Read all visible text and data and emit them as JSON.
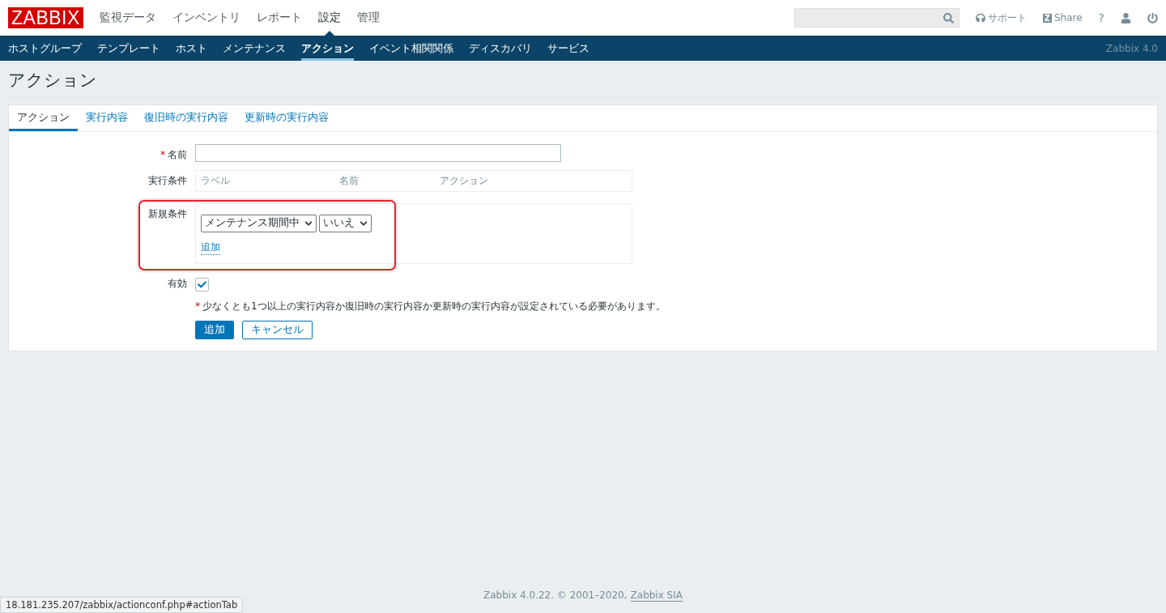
{
  "header": {
    "logo": "ZABBIX",
    "menu": [
      {
        "label": "監視データ",
        "selected": false
      },
      {
        "label": "インベントリ",
        "selected": false
      },
      {
        "label": "レポート",
        "selected": false
      },
      {
        "label": "設定",
        "selected": true
      },
      {
        "label": "管理",
        "selected": false
      }
    ],
    "support": "サポート",
    "share_logo": "Z",
    "share": "Share",
    "help": "?"
  },
  "subnav": {
    "items": [
      {
        "label": "ホストグループ",
        "selected": false
      },
      {
        "label": "テンプレート",
        "selected": false
      },
      {
        "label": "ホスト",
        "selected": false
      },
      {
        "label": "メンテナンス",
        "selected": false
      },
      {
        "label": "アクション",
        "selected": true
      },
      {
        "label": "イベント相関関係",
        "selected": false
      },
      {
        "label": "ディスカバリ",
        "selected": false
      },
      {
        "label": "サービス",
        "selected": false
      }
    ],
    "version": "Zabbix 4.0"
  },
  "page_title": "アクション",
  "tabs": [
    {
      "label": "アクション",
      "selected": true
    },
    {
      "label": "実行内容",
      "selected": false
    },
    {
      "label": "復旧時の実行内容",
      "selected": false
    },
    {
      "label": "更新時の実行内容",
      "selected": false
    }
  ],
  "form": {
    "name": {
      "label": "名前",
      "required": true
    },
    "conditions": {
      "label": "実行条件",
      "columns": [
        "ラベル",
        "名前",
        "アクション"
      ]
    },
    "new_condition": {
      "label": "新規条件",
      "type_value": "メンテナンス期間中",
      "operator_value": "いいえ",
      "add_link": "追加"
    },
    "enabled": {
      "label": "有効",
      "checked": true
    },
    "note_mark": "*",
    "note": "少なくとも1つ以上の実行内容か復旧時の実行内容か更新時の実行内容が設定されている必要があります。",
    "buttons": [
      {
        "label": "追加",
        "kind": "primary"
      },
      {
        "label": "キャンセル",
        "kind": "secondary"
      }
    ]
  },
  "footer": {
    "text": "Zabbix 4.0.22. © 2001–2020,",
    "link": "Zabbix SIA"
  },
  "status_url": "18.181.235.207/zabbix/actionconf.php#actionTab"
}
